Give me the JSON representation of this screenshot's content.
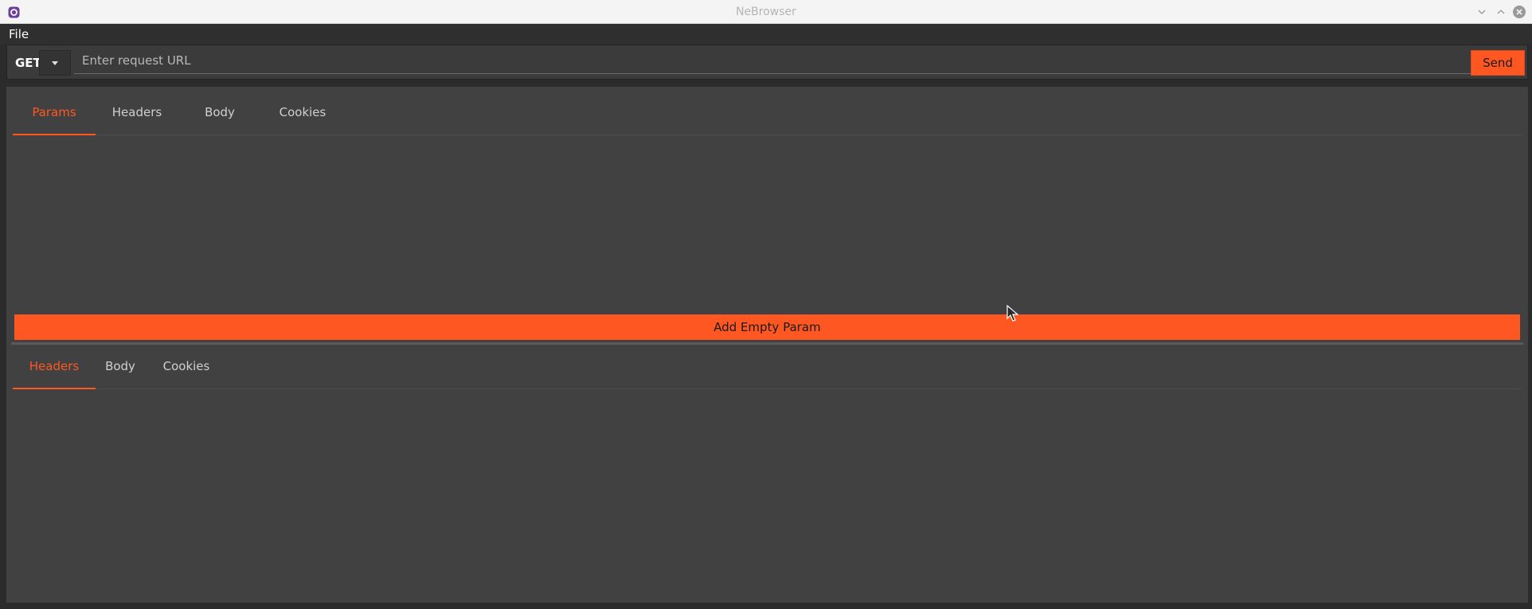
{
  "window": {
    "title": "NeBrowser",
    "accent_color": "#ff5722",
    "icons": [
      "app-icon",
      "minimize-icon",
      "maximize-icon",
      "close-icon"
    ]
  },
  "menubar": {
    "items": [
      {
        "label": "File"
      }
    ]
  },
  "request": {
    "method": "GET",
    "url_placeholder": "Enter request URL",
    "url_value": "",
    "send_label": "Send",
    "tabs": [
      {
        "label": "Params",
        "active": true
      },
      {
        "label": "Headers",
        "active": false
      },
      {
        "label": "Body",
        "active": false
      },
      {
        "label": "Cookies",
        "active": false
      }
    ],
    "add_param_label": "Add Empty Param"
  },
  "response": {
    "tabs": [
      {
        "label": "Headers",
        "active": true
      },
      {
        "label": "Body",
        "active": false
      },
      {
        "label": "Cookies",
        "active": false
      }
    ]
  }
}
